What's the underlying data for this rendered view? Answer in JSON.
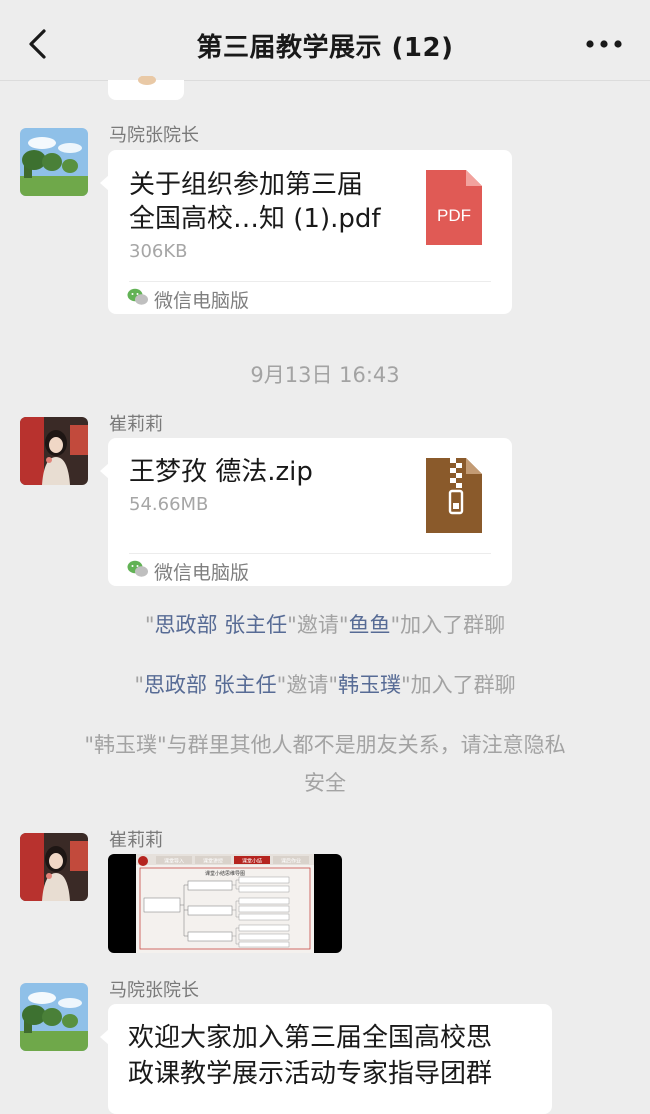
{
  "header": {
    "title": "第三届教学展示 (12)",
    "back_icon": "chevron-left-icon",
    "more_icon": "more-dots-icon"
  },
  "messages": [
    {
      "sender": "马院张院长",
      "file_name_line1": "关于组织参加第三届",
      "file_name_line2": "全国高校…知 (1).pdf",
      "file_size": "306KB",
      "file_icon_text": "PDF",
      "source": "微信电脑版"
    },
    {
      "timestamp": "9月13日 16:43"
    },
    {
      "sender": "崔莉莉",
      "file_name": "王梦孜 德法.zip",
      "file_size": "54.66MB",
      "source": "微信电脑版"
    },
    {
      "sys1": {
        "q1": "\"",
        "name1": "思政部 张主任",
        "q2": "\"邀请\"",
        "name2": "鱼鱼",
        "q3": "\"加入了群聊"
      },
      "sys2": {
        "q1": "\"",
        "name1": "思政部 张主任",
        "q2": "\"邀请\"",
        "name2": "韩玉璞",
        "q3": "\"加入了群聊"
      },
      "sys3": {
        "line1": "\"韩玉璞\"与群里其他人都不是朋友关系，请注意隐私",
        "line2": "安全"
      }
    },
    {
      "sender": "崔莉莉",
      "image": {
        "tabs": [
          "课堂导入",
          "课堂讲授",
          "课堂小结",
          "课后作业"
        ],
        "heading": "课堂小结思维导图"
      }
    },
    {
      "sender": "马院张院长",
      "text_line1": "欢迎大家加入第三届全国高校思",
      "text_line2": "政课教学展示活动专家指导团群"
    }
  ],
  "colors": {
    "background": "#ededed",
    "bubble": "#ffffff",
    "link": "#576b95",
    "pdf_icon": "#e05a55",
    "zip_icon": "#8a5a2b"
  }
}
